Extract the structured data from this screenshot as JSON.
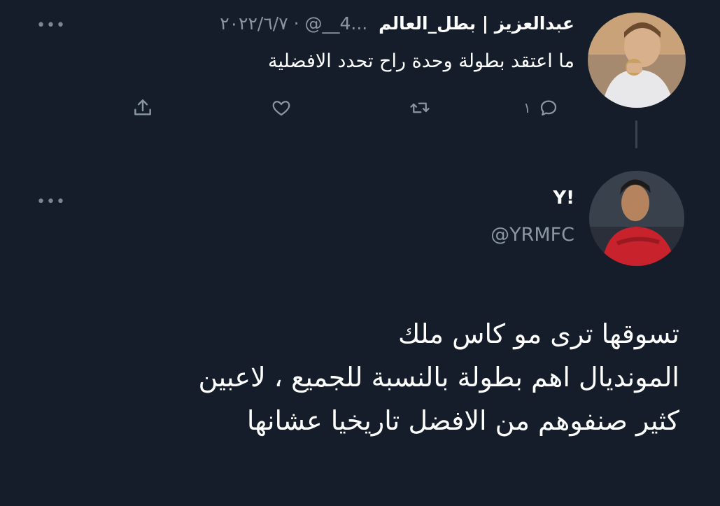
{
  "reply": {
    "author_name": "عبدالعزيز | بطل_العالم",
    "meta": "...4__@ · ٢٠٢٢/٦/٧",
    "text": "ما اعتقد بطولة وحدة راح تحدد الافضلية",
    "more": "•••",
    "actions": {
      "reply_count": "١",
      "reply_icon": "reply-icon",
      "retweet_icon": "retweet-icon",
      "like_icon": "heart-icon",
      "share_icon": "share-icon"
    }
  },
  "tweet": {
    "author_name": "Y!",
    "handle": "@YRMFC",
    "more": "•••",
    "lines": [
      "تسوقها ترى مو كاس ملك",
      "المونديال اهم بطولة بالنسبة للجميع ، لاعبين",
      "كثير صنفوهم من الافضل تاريخيا عشانها"
    ]
  },
  "colors": {
    "background": "#151d2a",
    "text_primary": "#ffffff",
    "text_secondary": "#8a96a3",
    "thread_line": "#3a4451"
  }
}
